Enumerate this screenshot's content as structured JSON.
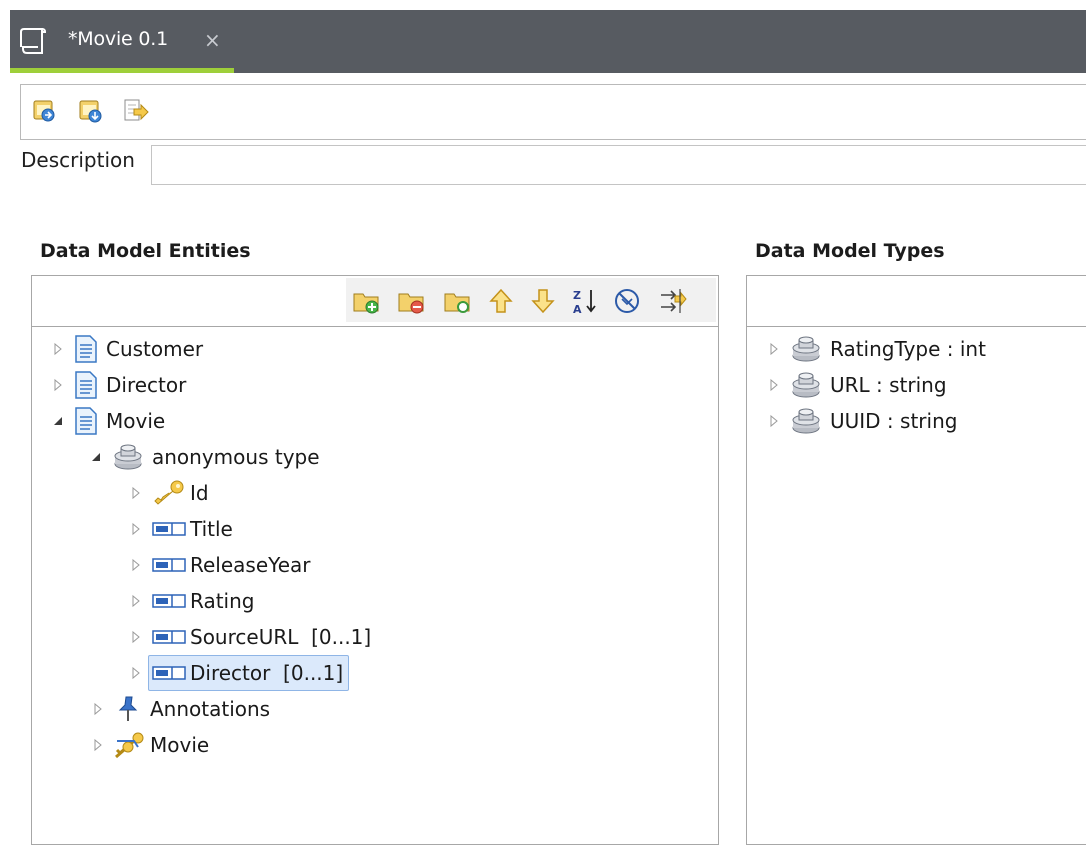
{
  "tab": {
    "title": "*Movie 0.1",
    "close_glyph": "×",
    "accent": "#9ecf3a"
  },
  "toolbar": {
    "buttons": [
      {
        "icon": "import-icon"
      },
      {
        "icon": "export-icon"
      },
      {
        "icon": "open-schema-icon"
      }
    ]
  },
  "description": {
    "label": "Description",
    "value": ""
  },
  "entities": {
    "title": "Data Model Entities",
    "tools": [
      {
        "icon": "add-entity-icon"
      },
      {
        "icon": "delete-entity-icon"
      },
      {
        "icon": "add-element-icon"
      },
      {
        "icon": "move-up-icon"
      },
      {
        "icon": "move-down-icon"
      },
      {
        "icon": "sort-az-icon"
      },
      {
        "icon": "filter-off-icon"
      },
      {
        "icon": "expand-collapse-icon"
      }
    ],
    "tree": {
      "customer": "Customer",
      "director": "Director",
      "movie": "Movie",
      "anonymous_type": "anonymous type",
      "id": "Id",
      "title": "Title",
      "release_year": "ReleaseYear",
      "rating": "Rating",
      "source_url": "SourceURL  [0...1]",
      "director_field": "Director  [0...1]",
      "annotations": "Annotations",
      "movie_key": "Movie"
    }
  },
  "types": {
    "title": "Data Model Types",
    "items": [
      "RatingType : int",
      "URL : string",
      "UUID : string"
    ]
  }
}
